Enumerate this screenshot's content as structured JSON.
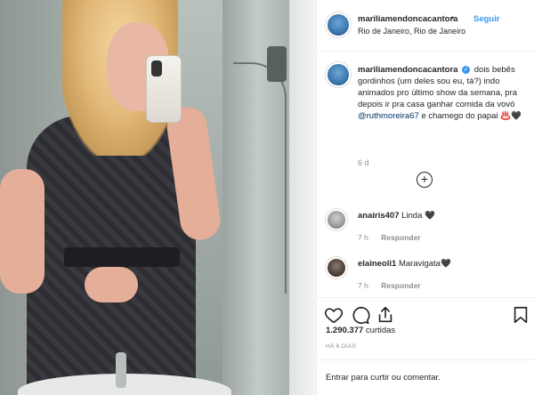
{
  "post": {
    "username": "mariliamendoncacantora",
    "follow_label": "Seguir",
    "separator": "•",
    "location": "Rio de Janeiro, Rio de Janeiro",
    "caption_text_1": "dois bebês gordinhos (um deles sou eu, tá?) indo animados pro último show da semana, pra depois ir pra casa ganhar comida da vovó",
    "caption_mention": "@ruthmoreira67",
    "caption_text_2": "e chamego do papai",
    "caption_emoji": "♨️🖤",
    "caption_time": "6 d",
    "load_more_icon": "+"
  },
  "comments": [
    {
      "user": "anairis407",
      "text": "Linda 🖤",
      "time": "7 h",
      "reply": "Responder"
    },
    {
      "user": "elaineoli1",
      "text": "Maravigata🖤",
      "time": "7 h",
      "reply": "Responder"
    }
  ],
  "engagement": {
    "likes_count": "1.290.377",
    "likes_label": "curtidas",
    "posted": "HÁ 6 DIAS"
  },
  "comment_box": {
    "login_label": "Entrar",
    "placeholder_rest": "para curtir ou comentar."
  },
  "icons": {
    "heart": "heart-icon",
    "comment": "comment-bubble-icon",
    "share": "share-icon",
    "save": "bookmark-icon"
  },
  "colors": {
    "accent": "#3897f0",
    "text": "#262626",
    "muted": "#8e8e8e",
    "border": "#efefef"
  }
}
